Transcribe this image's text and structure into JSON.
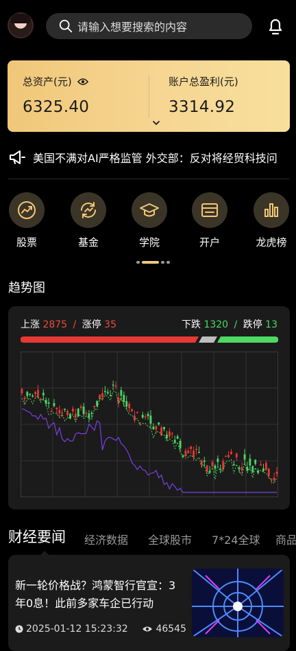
{
  "header": {
    "search_placeholder": "请输入想要搜索的内容"
  },
  "asset_card": {
    "total_label": "总资产(元)",
    "total_value": "6325.40",
    "profit_label": "账户总盈利(元)",
    "profit_value": "3314.92"
  },
  "notice": {
    "text": "美国不满对AI严格监管 外交部：反对将经贸科技问"
  },
  "menu": {
    "items": [
      {
        "label": "股票",
        "icon": "trend-up-icon"
      },
      {
        "label": "基金",
        "icon": "refresh-chart-icon"
      },
      {
        "label": "学院",
        "icon": "graduation-cap-icon"
      },
      {
        "label": "开户",
        "icon": "account-card-icon"
      },
      {
        "label": "龙虎榜",
        "icon": "bar-chart-icon"
      }
    ]
  },
  "trend": {
    "title": "趋势图",
    "rise_label": "上涨",
    "rise_count": "2875",
    "limit_up_label": "涨停",
    "limit_up_count": "35",
    "fall_label": "下跌",
    "fall_count": "1320",
    "limit_down_label": "跌停",
    "limit_down_count": "13",
    "colors": {
      "up": "#e53935",
      "down": "#4cd964",
      "flat": "#bdbdbd",
      "line2": "#7b3fe4"
    }
  },
  "news": {
    "tabs": [
      "财经要闻",
      "经济数据",
      "全球股市",
      "7*24全球",
      "商品"
    ],
    "article": {
      "title": "新一轮价格战？鸿蒙智行官宣：3年0息！此前多家车企已行动",
      "datetime": "2025-01-12  15:23:32",
      "views": "46545"
    }
  }
}
